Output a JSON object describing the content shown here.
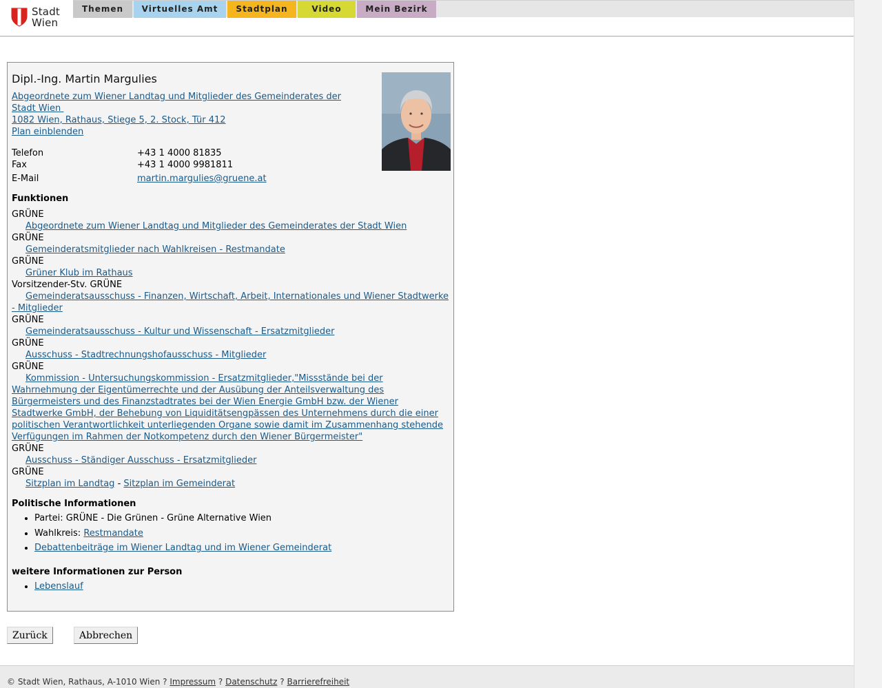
{
  "header": {
    "logo_line1": "Stadt",
    "logo_line2": "Wien",
    "tabs": [
      {
        "label": "Themen",
        "color": "#c9c9c9"
      },
      {
        "label": "Virtuelles Amt",
        "color": "#a7d3ee"
      },
      {
        "label": "Stadtplan",
        "color": "#f4b51e"
      },
      {
        "label": "Video",
        "color": "#d6d934"
      },
      {
        "label": "Mein Bezirk",
        "color": "#c8abc4"
      }
    ]
  },
  "person": {
    "name": "Dipl.-Ing. Martin Margulies",
    "org_link": "Abgeordnete zum Wiener Landtag und Mitglieder des Gemeinderates der Stadt Wien",
    "address_link": "1082 Wien, Rathaus, Stiege 5, 2. Stock, Tür 412",
    "plan_link": "Plan einblenden",
    "contact": {
      "phone_label": "Telefon",
      "phone": "+43 1 4000 81835",
      "fax_label": "Fax",
      "fax": "+43 1 4000 9981811",
      "email_label": "E-Mail",
      "email": "martin.margulies@gruene.at"
    }
  },
  "functions": {
    "heading": "Funktionen",
    "items": [
      {
        "party": "GRÜNE",
        "link": "Abgeordnete zum Wiener Landtag und Mitglieder des Gemeinderates der Stadt Wien"
      },
      {
        "party": "GRÜNE",
        "link": "Gemeinderatsmitglieder nach Wahlkreisen - Restmandate"
      },
      {
        "party": "GRÜNE",
        "link": "Grüner Klub im Rathaus"
      },
      {
        "party": "Vorsitzender-Stv. GRÜNE",
        "link": "Gemeinderatsausschuss - Finanzen, Wirtschaft, Arbeit, Internationales und Wiener Stadtwerke - Mitglieder"
      },
      {
        "party": "GRÜNE",
        "link": "Gemeinderatsausschuss - Kultur und Wissenschaft - Ersatzmitglieder"
      },
      {
        "party": "GRÜNE",
        "link": "Ausschuss - Stadtrechnungshofausschuss - Mitglieder"
      },
      {
        "party": "GRÜNE",
        "link": "Kommission - Untersuchungskommission - Ersatzmitglieder,\"Missstände bei der Wahrnehmung der Eigentümerrechte und der Ausübung der Anteilsverwaltung des Bürgermeisters und des Finanzstadtrates bei der Wien Energie GmbH bzw. der Wiener Stadtwerke GmbH, der Behebung von Liquiditätsengpässen des Unternehmens durch die einer politischen Verantwortlichkeit unterliegenden Organe sowie damit im Zusammenhang stehende Verfügungen im Rahmen der Notkompetenz durch den Wiener Bürgermeister\""
      },
      {
        "party": "GRÜNE",
        "link": "Ausschuss - Ständiger Ausschuss - Ersatzmitglieder"
      }
    ],
    "last_party": "GRÜNE",
    "seat_landtag": "Sitzplan im Landtag",
    "seat_sep": "-",
    "seat_gemeinderat": "Sitzplan im Gemeinderat"
  },
  "political": {
    "heading": "Politische Informationen",
    "party_text": "Partei: GRÜNE - Die Grünen - Grüne Alternative Wien",
    "wahlkreis_label": "Wahlkreis:",
    "wahlkreis_link": "Restmandate",
    "debate_link": "Debattenbeiträge im Wiener Landtag und im Wiener Gemeinderat"
  },
  "more": {
    "heading": "weitere Informationen zur Person",
    "cv_link": "Lebenslauf"
  },
  "buttons": {
    "back": "Zurück",
    "cancel": "Abbrechen"
  },
  "footer": {
    "copyright": "© Stadt Wien, Rathaus, A-1010 Wien",
    "sep": "?",
    "impressum": "Impressum",
    "datenschutz": "Datenschutz",
    "barrierefreiheit": "Barrierefreiheit"
  }
}
